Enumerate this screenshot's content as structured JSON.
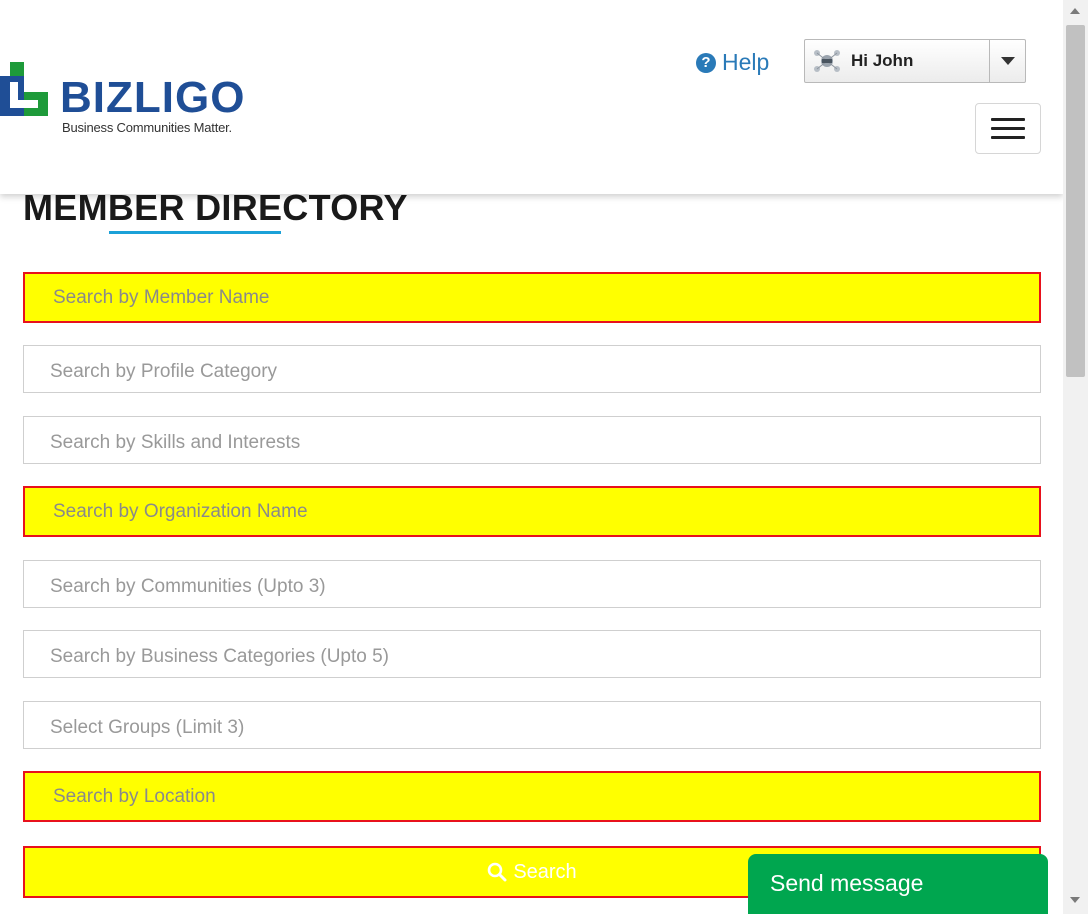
{
  "header": {
    "logo": {
      "word": "BIZLIGO",
      "tagline": "Business Communities Matter."
    },
    "help_label": "Help",
    "user_greeting": "Hi John"
  },
  "page_title": "MEMBER DIRECTORY",
  "search_fields": {
    "member_name": "Search by Member Name",
    "profile_category": "Search by Profile Category",
    "skills_interests": "Search by Skills and Interests",
    "organization_name": "Search by Organization Name",
    "communities": "Search by Communities (Upto 3)",
    "business_categories": "Search by Business Categories (Upto 5)",
    "groups": "Select Groups (Limit 3)",
    "location": "Search by Location"
  },
  "search_button_label": "Search",
  "chat_widget_label": "Send message",
  "colors": {
    "brand_blue": "#1f4e96",
    "logo_green": "#1e9a3a",
    "link_blue": "#2a7ab8",
    "accent_underline": "#1ba1d8",
    "highlight_fill": "#ffff00",
    "highlight_border": "#e8111c",
    "chat_green": "#00a64f"
  },
  "icons": {
    "help": "question-circle-icon",
    "user_menu_caret": "caret-down-icon",
    "menu": "hamburger-icon",
    "search": "search-icon"
  }
}
